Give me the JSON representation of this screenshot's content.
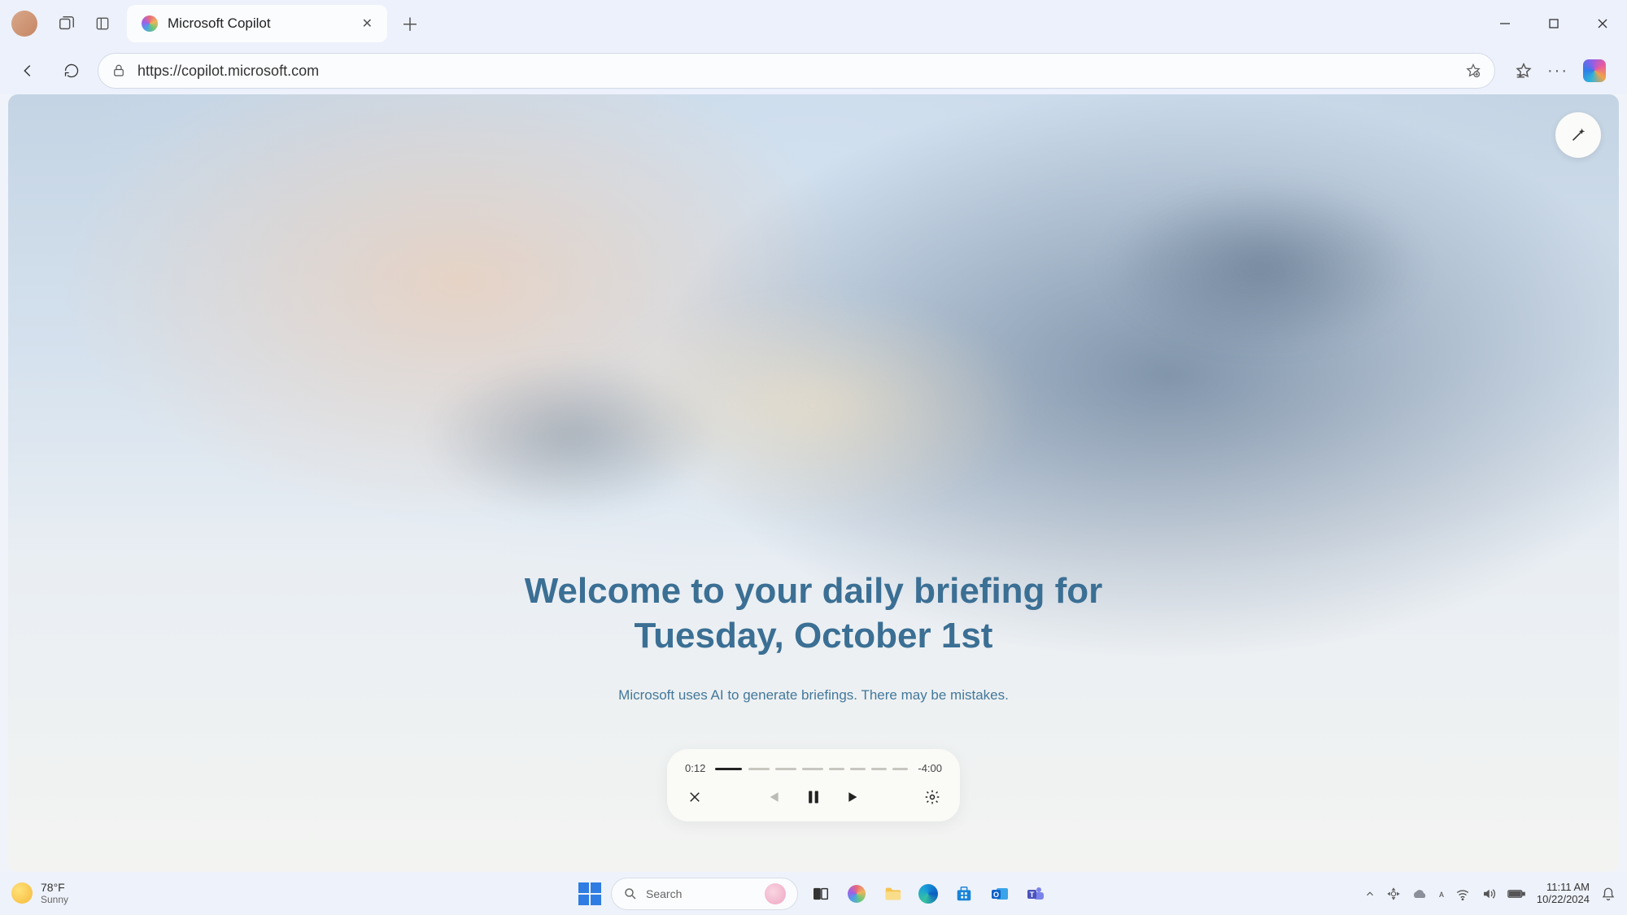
{
  "browser": {
    "tab_title": "Microsoft Copilot",
    "url": "https://copilot.microsoft.com"
  },
  "page": {
    "headline_line1": "Welcome to your daily briefing for",
    "headline_line2": "Tuesday, October 1st",
    "disclaimer": "Microsoft uses AI to generate briefings. There may be mistakes."
  },
  "player": {
    "elapsed": "0:12",
    "remaining": "-4:00"
  },
  "taskbar": {
    "weather_temp": "78°F",
    "weather_cond": "Sunny",
    "search_placeholder": "Search",
    "time": "11:11 AM",
    "date": "10/22/2024"
  }
}
